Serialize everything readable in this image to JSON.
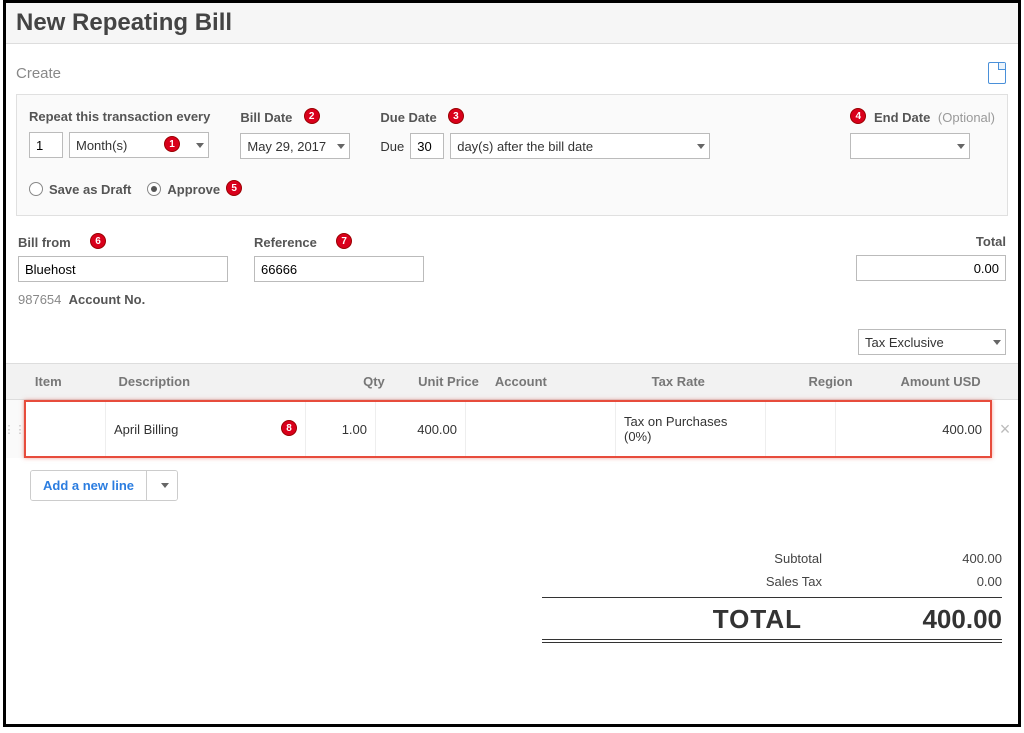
{
  "header": {
    "title": "New Repeating Bill",
    "create_label": "Create"
  },
  "repeat": {
    "label": "Repeat this transaction every",
    "interval_value": "1",
    "interval_unit": "Month(s)"
  },
  "bill_date": {
    "label": "Bill Date",
    "value": "May 29, 2017"
  },
  "due_date": {
    "label": "Due Date",
    "due_prefix": "Due",
    "days_value": "30",
    "mode": "day(s) after the bill date"
  },
  "end_date": {
    "label": "End Date",
    "optional_label": "(Optional)",
    "value": ""
  },
  "status": {
    "draft_label": "Save as Draft",
    "approve_label": "Approve",
    "selected": "approve"
  },
  "bill_from": {
    "label": "Bill from",
    "value": "Bluehost"
  },
  "reference": {
    "label": "Reference",
    "value": "66666"
  },
  "total_field": {
    "label": "Total",
    "value": "0.00"
  },
  "account_no": {
    "number": "987654",
    "label": "Account No."
  },
  "tax_mode": "Tax Exclusive",
  "columns": {
    "item": "Item",
    "description": "Description",
    "qty": "Qty",
    "unit_price": "Unit Price",
    "account": "Account",
    "tax_rate": "Tax Rate",
    "region": "Region",
    "amount": "Amount USD"
  },
  "line": {
    "item": "",
    "description": "April Billing",
    "qty": "1.00",
    "unit_price": "400.00",
    "account": "",
    "tax_rate": "Tax on Purchases (0%)",
    "region": "",
    "amount": "400.00"
  },
  "add_line_label": "Add a new line",
  "totals": {
    "subtotal_label": "Subtotal",
    "subtotal": "400.00",
    "salestax_label": "Sales Tax",
    "salestax": "0.00",
    "total_label": "TOTAL",
    "total": "400.00"
  },
  "badges": {
    "b1": "1",
    "b2": "2",
    "b3": "3",
    "b4": "4",
    "b5": "5",
    "b6": "6",
    "b7": "7",
    "b8": "8"
  }
}
